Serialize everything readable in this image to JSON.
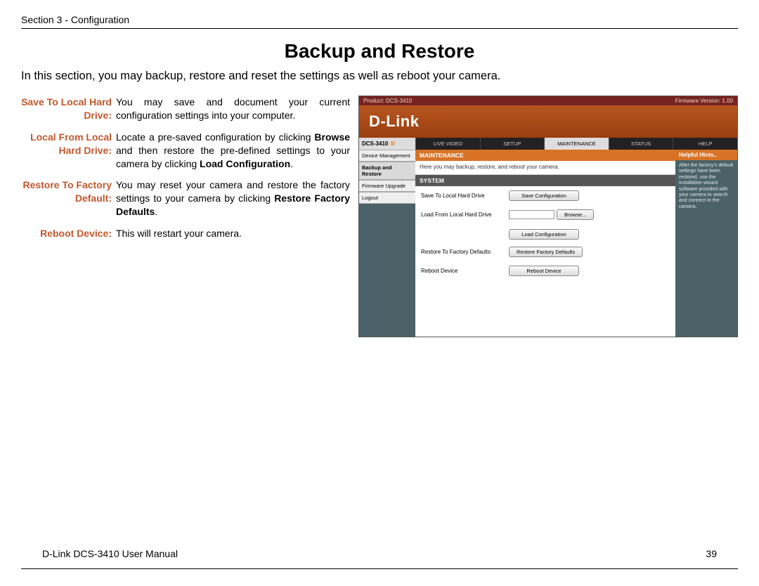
{
  "header": {
    "section_label": "Section 3 - Configuration"
  },
  "title": "Backup and Restore",
  "intro": "In this section, you may backup, restore and reset the settings as well as reboot your camera.",
  "defs": [
    {
      "term1": "Save To Local Hard",
      "term2": "Drive:",
      "body": "You may save and document your current configuration settings into your computer."
    },
    {
      "term1": "Local From Local",
      "term2": "Hard Drive:",
      "body_html": "Locate a pre-saved configuration by clicking <b>Browse</b> and then restore the pre-defined settings to your camera by clicking <b>Load Configuration</b>."
    },
    {
      "term1": "Restore To Factory",
      "term2": "Default:",
      "body_html": "You may reset your camera and restore the factory settings to your camera by clicking <b>Restore Factory Defaults</b>."
    },
    {
      "term1": "Reboot Device:",
      "term2": "",
      "body": "This will restart your camera."
    }
  ],
  "shot": {
    "product": "Product: DCS-3410",
    "firmware": "Firmware Version: 1.00",
    "brand": "D-Link",
    "model": "DCS-3410",
    "tabs": [
      "LIVE VIDEO",
      "SETUP",
      "MAINTENANCE",
      "STATUS",
      "HELP"
    ],
    "side_items": [
      "Device Management",
      "Backup and Restore",
      "Firmware Upgrade",
      "Logout"
    ],
    "maint_header": "MAINTENANCE",
    "sub_desc": "Here you may backup, restore, and reboot your camera.",
    "sys_header": "SYSTEM",
    "rows": {
      "save_label": "Save To Local Hard Drive",
      "save_btn": "Save Configuration",
      "load_label": "Load From Local Hard Drive",
      "browse_btn": "Browse...",
      "load_btn": "Load Configuration",
      "restore_label": "Restore To Factory Defaults",
      "restore_btn": "Restore Factory Defaults",
      "reboot_label": "Reboot Device",
      "reboot_btn": "Reboot Device"
    },
    "help": {
      "title": "Helpful Hints..",
      "text": "After the factory's default settings have been restored, use the installation wizard software provided with your camera to search and connect to the camera."
    }
  },
  "footer": {
    "left": "D-Link DCS-3410 User Manual",
    "right": "39"
  }
}
